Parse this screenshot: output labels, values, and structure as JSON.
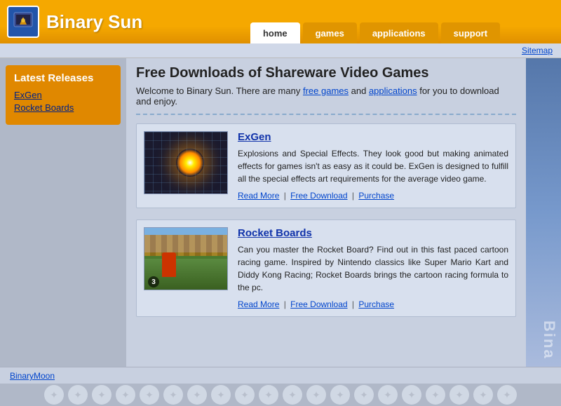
{
  "header": {
    "logo_text": "Binary Sun",
    "nav": {
      "items": [
        {
          "label": "home",
          "active": true
        },
        {
          "label": "games",
          "active": false
        },
        {
          "label": "applications",
          "active": false
        },
        {
          "label": "support",
          "active": false
        }
      ]
    }
  },
  "sitemap_bar": {
    "link": "Sitemap"
  },
  "sidebar": {
    "section_title": "Latest Releases",
    "links": [
      {
        "label": "ExGen"
      },
      {
        "label": "Rocket Boards"
      }
    ]
  },
  "content": {
    "title": "Free Downloads of Shareware Video Games",
    "intro": "Welcome to Binary Sun. There are many ",
    "intro_link1": "free games",
    "intro_mid": " and ",
    "intro_link2": "applications",
    "intro_end": " for you to download and enjoy.",
    "products": [
      {
        "name": "ExGen",
        "description": "Explosions and Special Effects. They look good but making animated effects for games isn't as easy as it could be. ExGen is designed to fulfill all the special effects art requirements for the average video game.",
        "link_more": "Read More",
        "link_download": "Free Download",
        "link_purchase": "Purchase"
      },
      {
        "name": "Rocket Boards",
        "description": "Can you master the Rocket Board? Find out in this fast paced cartoon racing game. Inspired by Nintendo classics like Super Mario Kart and Diddy Kong Racing; Rocket Boards brings the cartoon racing formula to the pc.",
        "link_more": "Read More",
        "link_download": "Free Download",
        "link_purchase": "Purchase"
      }
    ]
  },
  "footer": {
    "link": "BinaryMoon"
  },
  "right_deco": {
    "text": "Bina"
  }
}
